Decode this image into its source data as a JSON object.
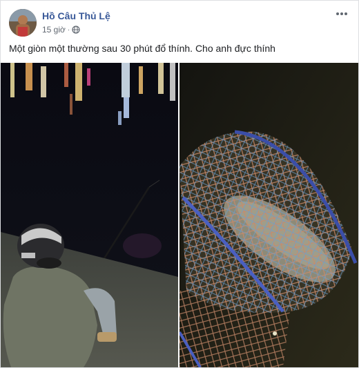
{
  "post": {
    "author": "Hồ Câu Thủ Lệ",
    "time": "15 giờ",
    "separator": "·",
    "text": "Một giòn một thường sau 30 phút đổ thính. Cho anh đực thính",
    "privacy_icon": "globe-icon",
    "menu_icon": "more-options-icon"
  },
  "colors": {
    "author_link": "#385898",
    "meta_text": "#606770",
    "border": "#dddfe2"
  }
}
